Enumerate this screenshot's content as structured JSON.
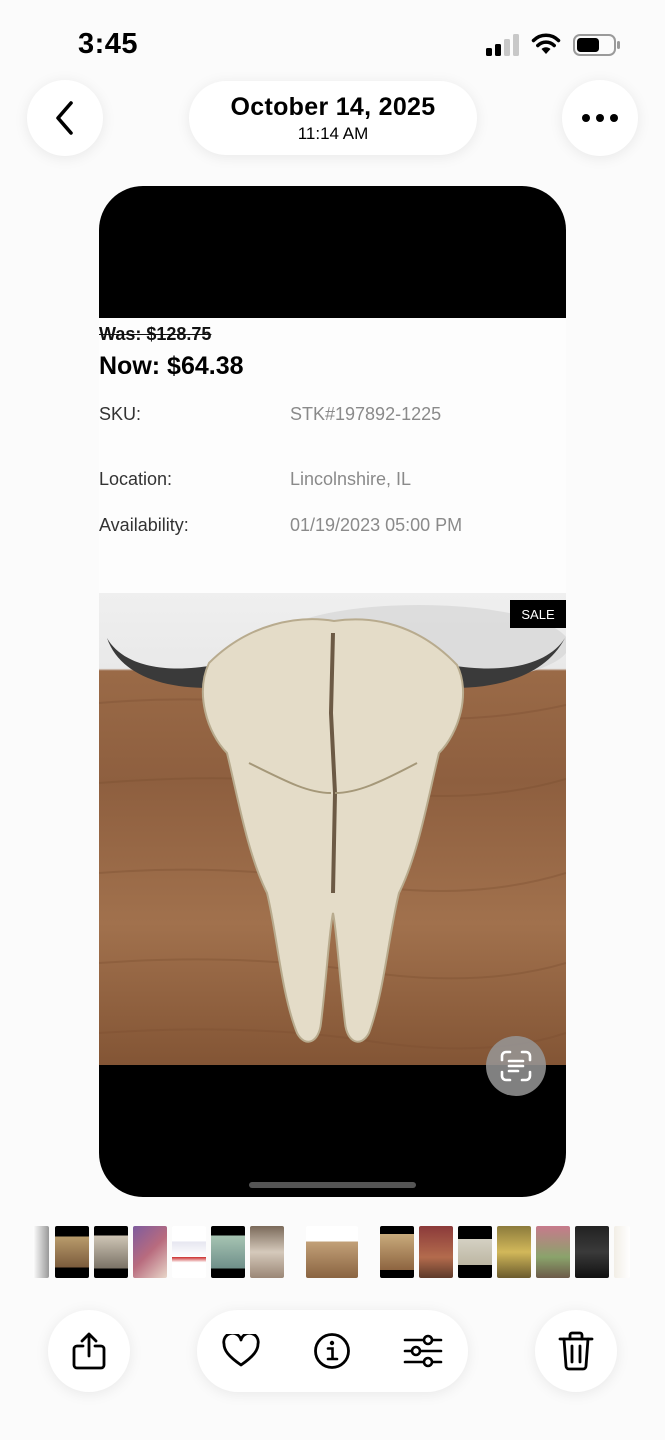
{
  "status_bar": {
    "time": "3:45"
  },
  "header": {
    "date": "October 14, 2025",
    "time": "11:14 AM"
  },
  "listing": {
    "was_price": "Was: $128.75",
    "now_price": "Now: $64.38",
    "rows": [
      {
        "label": "SKU:",
        "value": "STK#197892-1225"
      },
      {
        "label": "Location:",
        "value": "Lincolnshire, IL"
      },
      {
        "label": "Availability:",
        "value": "01/19/2023 05:00 PM"
      }
    ],
    "sale_tag": "SALE"
  },
  "icons": {
    "top": [
      "back-chevron-icon",
      "more-dots-icon"
    ],
    "bottom": [
      "share-icon",
      "heart-icon",
      "info-icon",
      "adjust-sliders-icon",
      "trash-icon"
    ],
    "overlay": "live-text-icon"
  }
}
